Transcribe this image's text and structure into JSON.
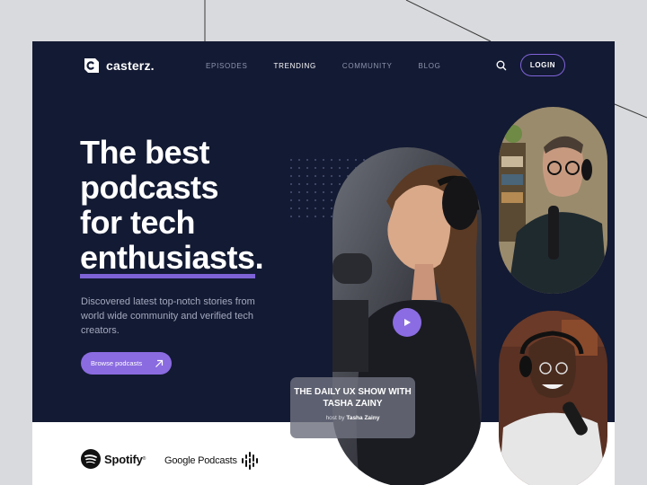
{
  "brand": {
    "name": "casterz."
  },
  "nav": {
    "items": [
      {
        "label": "EPISODES",
        "active": false
      },
      {
        "label": "TRENDING",
        "active": true
      },
      {
        "label": "COMMUNITY",
        "active": false
      },
      {
        "label": "BLOG",
        "active": false
      }
    ],
    "login_label": "LOGIN",
    "search_icon": "search-icon"
  },
  "hero": {
    "title_lines": [
      "The best",
      "podcasts",
      "for tech"
    ],
    "title_highlight": "enthusiasts",
    "title_end": ".",
    "description": "Discovered latest top-notch stories from world wide community and verified tech creators.",
    "cta_label": "Browse podcasts",
    "cta_icon": "arrow-up-right-icon"
  },
  "featured_show": {
    "title": "THE DAILY UX SHOW WITH TASHA ZAINY",
    "host_prefix": "host by",
    "host_name": "Tasha Zainy"
  },
  "partners": [
    {
      "name": "Spotify",
      "mark": "®"
    },
    {
      "name": "Google Podcasts"
    }
  ],
  "colors": {
    "background": "#131a33",
    "accent": "#8a6be0",
    "text": "#ffffff",
    "muted": "#8e95ad"
  }
}
